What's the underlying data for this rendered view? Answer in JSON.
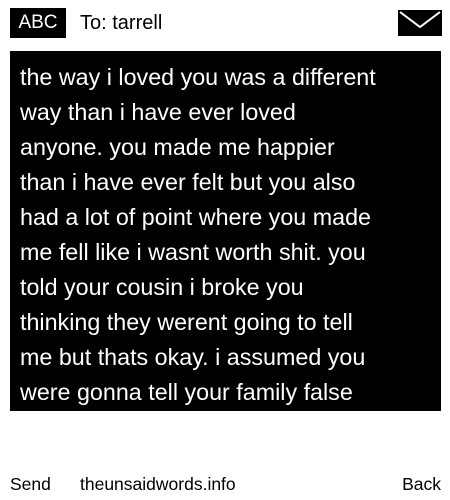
{
  "header": {
    "input_mode": "ABC",
    "to_prefix": "To:",
    "recipient": "tarrell",
    "envelope_icon": "envelope-icon"
  },
  "message": {
    "text": "the way i loved you was a different\nway than i have ever loved\nanyone. you made me happier\nthan i have ever felt but you also\nhad a lot of point where you made\nme fell like i wasnt worth shit. you\ntold your cousin i broke you\nthinking they werent going to tell\nme but thats okay. i assumed you\nwere gonna tell your family false"
  },
  "footer": {
    "send_label": "Send",
    "site_label": "theunsaidwords.info",
    "back_label": "Back"
  },
  "colors": {
    "background": "#ffffff",
    "message_background": "#000000",
    "message_text": "#ffffff"
  }
}
